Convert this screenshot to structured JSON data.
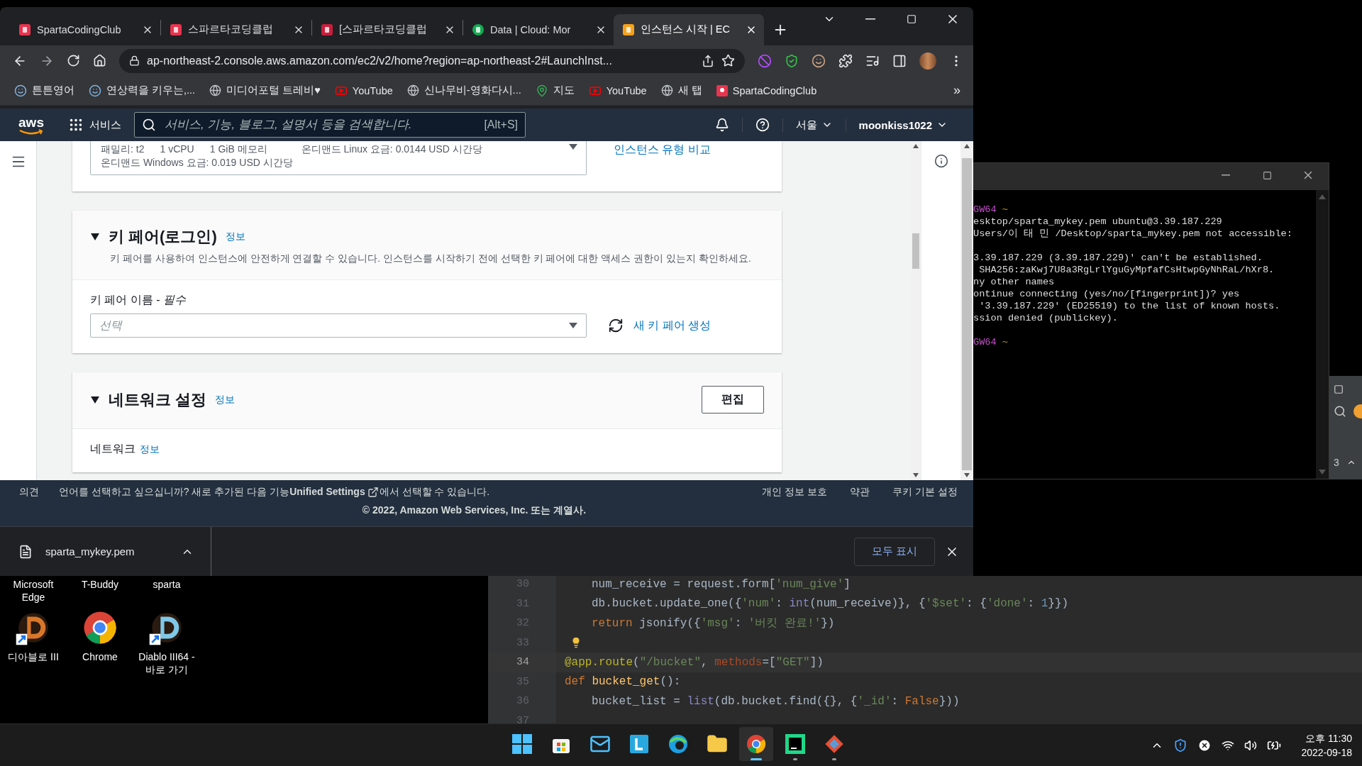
{
  "browser": {
    "tabs": [
      {
        "title": "SpartaCodingClub",
        "selected": false
      },
      {
        "title": "스파르타코딩클럽",
        "selected": false
      },
      {
        "title": "[스파르타코딩클럽",
        "selected": false
      },
      {
        "title": "Data | Cloud: Mor",
        "selected": false
      },
      {
        "title": "인스턴스 시작 | EC",
        "selected": true
      }
    ],
    "address": "ap-northeast-2.console.aws.amazon.com/ec2/v2/home?region=ap-northeast-2#LaunchInst...",
    "bookmarks": [
      "튼튼영어",
      "연상력을 키우는,...",
      "미디어포털 트레비♥",
      "YouTube",
      "신나무비-영화다시...",
      "지도",
      "YouTube",
      "새 탭",
      "SpartaCodingClub"
    ],
    "bookmarks_more": "»"
  },
  "aws_nav": {
    "logo": "aws",
    "services": "서비스",
    "search_placeholder": "서비스, 기능, 블로그, 설명서 등을 검색합니다.",
    "shortcut": "[Alt+S]",
    "region": "서울",
    "account": "moonkiss1022"
  },
  "instance_type": {
    "specs": [
      "패밀리: t2",
      "1 vCPU",
      "1 GiB 메모리",
      "온디맨드 Linux 요금: 0.0144 USD 시간당"
    ],
    "windows_price": "온디맨드 Windows 요금: 0.019 USD 시간당",
    "compare_link": "인스턴스 유형 비교"
  },
  "key_pair": {
    "title": "키 페어(로그인)",
    "info": "정보",
    "expanded": true,
    "description": "키 페어를 사용하여 인스턴스에 안전하게 연결할 수 있습니다. 인스턴스를 시작하기 전에 선택한 키 페어에 대한 액세스 권한이 있는지 확인하세요.",
    "field_label": "키 페어 이름 - *필수*",
    "select_placeholder": "선택",
    "create_link": "새 키 페어 생성"
  },
  "network": {
    "title": "네트워크 설정",
    "info": "정보",
    "expanded": true,
    "edit_button": "편집",
    "field_label": "네트워크",
    "field_info": "정보"
  },
  "footer": {
    "feedback": "의견",
    "notice_before": "언어를 선택하고 싶으십니까? 새로 추가된 다음 기능**Unified Settings**",
    "notice_after": "에서 선택할 수 있습니다.",
    "links": [
      "개인 정보 보호",
      "약관",
      "쿠키 기본 설정"
    ],
    "copyright": "© 2022, Amazon Web Services, Inc. 또는 계열사."
  },
  "download": {
    "file": "sparta_mykey.pem",
    "show_all": "모두 표시"
  },
  "terminal": {
    "lines": [
      {
        "kind": "prompt",
        "host": "GW64",
        "tail": "~"
      },
      {
        "kind": "output",
        "text": "esktop/sparta_mykey.pem ubuntu@3.39.187.229"
      },
      {
        "kind": "output",
        "text": "Users/이 태 민 /Desktop/sparta_mykey.pem not accessible:"
      },
      {
        "kind": "blank"
      },
      {
        "kind": "output",
        "text": "3.39.187.229 (3.39.187.229)' can't be established."
      },
      {
        "kind": "output",
        "text": " SHA256:zaKwj7U8a3RgLrlYguGyMpfafCsHtwpGyNhRaL/hXr8."
      },
      {
        "kind": "output",
        "text": "ny other names"
      },
      {
        "kind": "output",
        "text": "ontinue connecting (yes/no/[fingerprint])? yes"
      },
      {
        "kind": "output",
        "text": " '3.39.187.229' (ED25519) to the list of known hosts."
      },
      {
        "kind": "output",
        "text": "ssion denied (publickey)."
      },
      {
        "kind": "blank"
      },
      {
        "kind": "prompt",
        "host": "GW64",
        "tail": "~"
      }
    ]
  },
  "side_panel": {
    "count": "3"
  },
  "editor": {
    "lines": [
      {
        "number": "30",
        "current": false,
        "indented": true,
        "hint": false,
        "tokens": [
          {
            "kind": "plain",
            "text": "num_receive = request.form["
          },
          {
            "kind": "str",
            "text": "'num_give'"
          },
          {
            "kind": "plain",
            "text": "]"
          }
        ]
      },
      {
        "number": "31",
        "current": false,
        "indented": true,
        "hint": false,
        "tokens": [
          {
            "kind": "plain",
            "text": "db.bucket.update_one({"
          },
          {
            "kind": "str",
            "text": "'num'"
          },
          {
            "kind": "plain",
            "text": ": "
          },
          {
            "kind": "builtin",
            "text": "int"
          },
          {
            "kind": "plain",
            "text": "(num_receive)}, {"
          },
          {
            "kind": "str",
            "text": "'$set'"
          },
          {
            "kind": "plain",
            "text": ": {"
          },
          {
            "kind": "str",
            "text": "'done'"
          },
          {
            "kind": "plain",
            "text": ": "
          },
          {
            "kind": "num",
            "text": "1"
          },
          {
            "kind": "plain",
            "text": "}})"
          }
        ]
      },
      {
        "number": "32",
        "current": false,
        "indented": true,
        "hint": false,
        "tokens": [
          {
            "kind": "kw",
            "text": "return "
          },
          {
            "kind": "plain",
            "text": "jsonify({"
          },
          {
            "kind": "str",
            "text": "'msg'"
          },
          {
            "kind": "plain",
            "text": ": "
          },
          {
            "kind": "str",
            "text": "'버킷 완료!'"
          },
          {
            "kind": "plain",
            "text": "})"
          }
        ]
      },
      {
        "number": "33",
        "current": false,
        "hint": true
      },
      {
        "number": "34",
        "current": true,
        "indented": false,
        "hint": false,
        "tokens": [
          {
            "kind": "deco",
            "text": "@app.route"
          },
          {
            "kind": "plain",
            "text": "("
          },
          {
            "kind": "str",
            "text": "\"/bucket\""
          },
          {
            "kind": "plain",
            "text": ", "
          },
          {
            "kind": "param",
            "text": "methods"
          },
          {
            "kind": "plain",
            "text": "=["
          },
          {
            "kind": "str",
            "text": "\"GET\""
          },
          {
            "kind": "plain",
            "text": "])"
          }
        ]
      },
      {
        "number": "35",
        "current": false,
        "indented": false,
        "hint": false,
        "tokens": [
          {
            "kind": "kw",
            "text": "def "
          },
          {
            "kind": "fn",
            "text": "bucket_get"
          },
          {
            "kind": "plain",
            "text": "():"
          }
        ]
      },
      {
        "number": "36",
        "current": false,
        "indented": true,
        "hint": false,
        "tokens": [
          {
            "kind": "plain",
            "text": "bucket_list = "
          },
          {
            "kind": "builtin",
            "text": "list"
          },
          {
            "kind": "plain",
            "text": "(db.bucket.find({}, {"
          },
          {
            "kind": "str",
            "text": "'_id'"
          },
          {
            "kind": "plain",
            "text": ": "
          },
          {
            "kind": "kw",
            "text": "False"
          },
          {
            "kind": "plain",
            "text": "}))"
          }
        ]
      },
      {
        "number": "37",
        "current": false,
        "hint": false
      }
    ]
  },
  "desktop": {
    "top_labels": [
      "Microsoft Edge",
      "T-Buddy",
      "sparta"
    ],
    "shortcuts": [
      "디아블로 III",
      "Chrome",
      "Diablo III64 - 바로 가기"
    ]
  },
  "taskbar": {
    "apps": [
      {
        "running": false,
        "selected": false
      },
      {
        "running": false,
        "selected": false
      },
      {
        "running": false,
        "selected": false
      },
      {
        "running": false,
        "selected": false
      },
      {
        "running": false,
        "selected": false
      },
      {
        "running": false,
        "selected": false
      },
      {
        "running": true,
        "selected": true
      },
      {
        "running": true,
        "selected": false
      },
      {
        "running": true,
        "selected": false
      }
    ],
    "time": "오후 11:30",
    "date": "2022-09-18"
  }
}
